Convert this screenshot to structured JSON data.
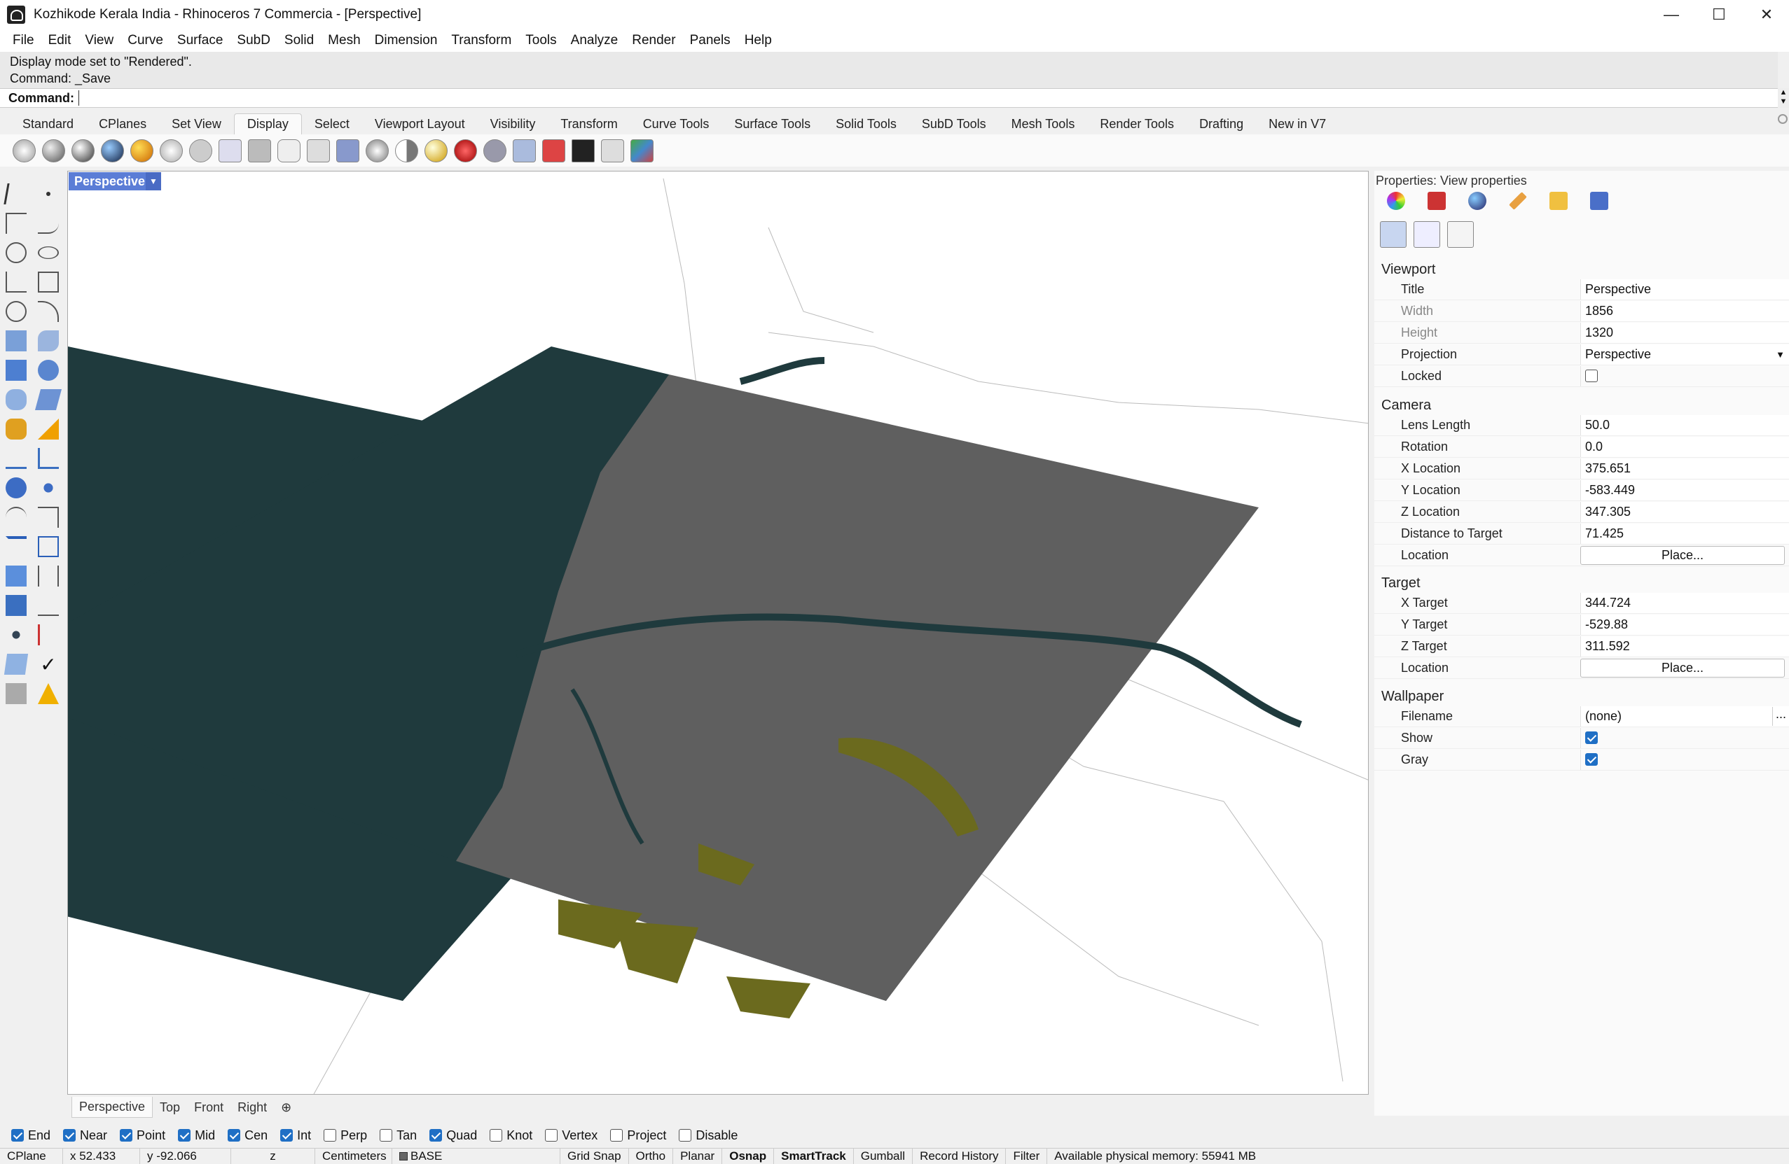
{
  "window": {
    "title": "Kozhikode Kerala India - Rhinoceros 7 Commercia - [Perspective]",
    "min": "—",
    "max": "☐",
    "close": "✕"
  },
  "menu": [
    "File",
    "Edit",
    "View",
    "Curve",
    "Surface",
    "SubD",
    "Solid",
    "Mesh",
    "Dimension",
    "Transform",
    "Tools",
    "Analyze",
    "Render",
    "Panels",
    "Help"
  ],
  "command": {
    "history1": "Display mode set to \"Rendered\".",
    "history2": "Command: _Save",
    "label": "Command:",
    "value": ""
  },
  "tabs": [
    "Standard",
    "CPlanes",
    "Set View",
    "Display",
    "Select",
    "Viewport Layout",
    "Visibility",
    "Transform",
    "Curve Tools",
    "Surface Tools",
    "Solid Tools",
    "SubD Tools",
    "Mesh Tools",
    "Render Tools",
    "Drafting",
    "New in V7"
  ],
  "activeTab": "Display",
  "viewport": {
    "label": "Perspective",
    "dropdown": "▼"
  },
  "viewTabs": [
    "Perspective",
    "Top",
    "Front",
    "Right",
    "⊕"
  ],
  "props": {
    "title": "Properties: View properties",
    "viewport": {
      "heading": "Viewport",
      "title_l": "Title",
      "title_v": "Perspective",
      "width_l": "Width",
      "width_v": "1856",
      "height_l": "Height",
      "height_v": "1320",
      "proj_l": "Projection",
      "proj_v": "Perspective",
      "locked_l": "Locked"
    },
    "camera": {
      "heading": "Camera",
      "lens_l": "Lens Length",
      "lens_v": "50.0",
      "rot_l": "Rotation",
      "rot_v": "0.0",
      "xl_l": "X Location",
      "xl_v": "375.651",
      "yl_l": "Y Location",
      "yl_v": "-583.449",
      "zl_l": "Z Location",
      "zl_v": "347.305",
      "dist_l": "Distance to Target",
      "dist_v": "71.425",
      "loc_l": "Location",
      "loc_b": "Place..."
    },
    "target": {
      "heading": "Target",
      "xt_l": "X Target",
      "xt_v": "344.724",
      "yt_l": "Y Target",
      "yt_v": "-529.88",
      "zt_l": "Z Target",
      "zt_v": "311.592",
      "loc_l": "Location",
      "loc_b": "Place..."
    },
    "wallpaper": {
      "heading": "Wallpaper",
      "file_l": "Filename",
      "file_v": "(none)",
      "file_b": "...",
      "show_l": "Show",
      "gray_l": "Gray"
    }
  },
  "osnap": [
    "End",
    "Near",
    "Point",
    "Mid",
    "Cen",
    "Int",
    "Perp",
    "Tan",
    "Quad",
    "Knot",
    "Vertex",
    "Project",
    "Disable"
  ],
  "status": {
    "cplane": "CPlane",
    "x": "x 52.433",
    "y": "y -92.066",
    "z": "z",
    "units": "Centimeters",
    "layer": "BASE",
    "grid": "Grid Snap",
    "ortho": "Ortho",
    "planar": "Planar",
    "osnap": "Osnap",
    "smart": "SmartTrack",
    "gumball": "Gumball",
    "record": "Record History",
    "filter": "Filter",
    "memory": "Available physical memory: 55941 MB"
  },
  "colors": {
    "ocean": "#1f3a3d",
    "land": "#5f5f5f",
    "wetland": "#6b6a1e",
    "accent": "#1f6fc5"
  }
}
